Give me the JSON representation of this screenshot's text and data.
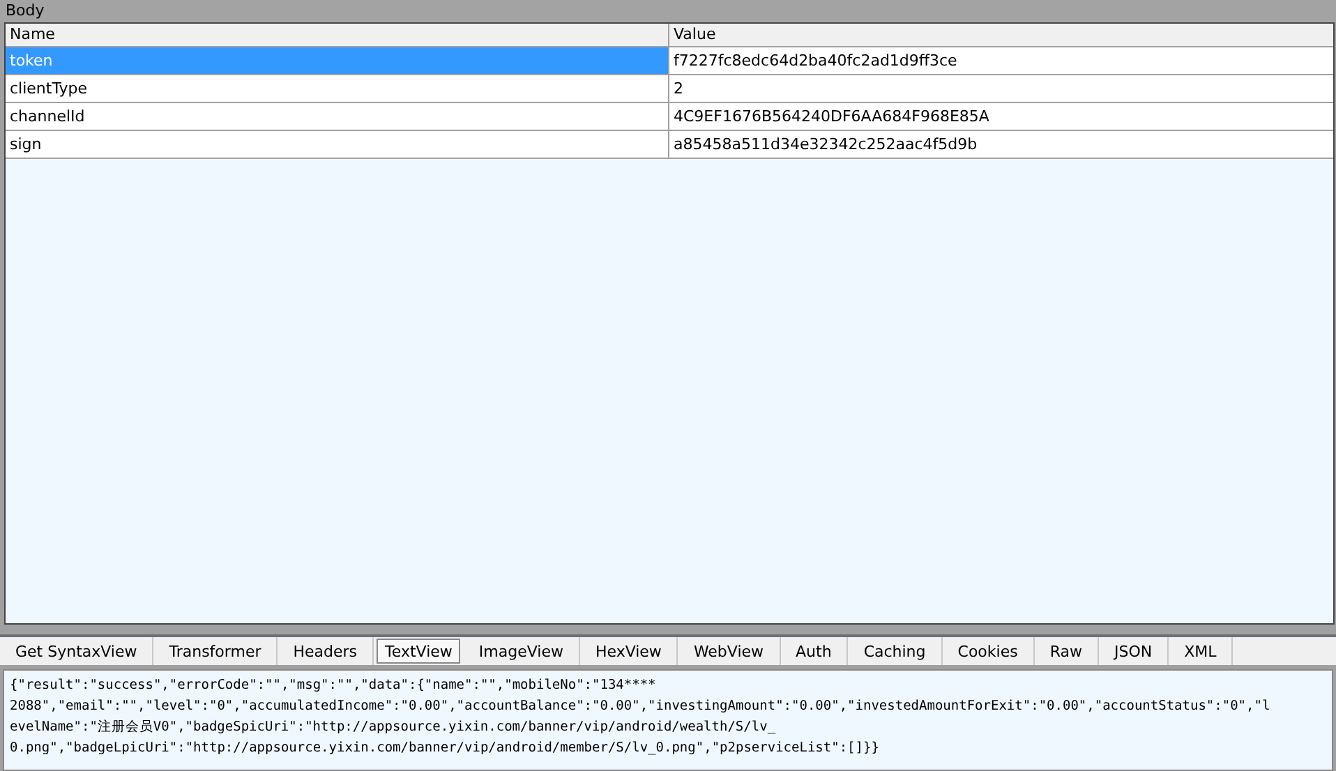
{
  "panel": {
    "title": "Body"
  },
  "table": {
    "columns": [
      "Name",
      "Value"
    ],
    "rows": [
      {
        "name": "token",
        "value": "f7227fc8edc64d2ba40fc2ad1d9ff3ce",
        "selected": true
      },
      {
        "name": "clientType",
        "value": "2",
        "selected": false
      },
      {
        "name": "channelId",
        "value": "4C9EF1676B564240DF6AA684F968E85A",
        "selected": false
      },
      {
        "name": "sign",
        "value": "a85458a511d34e32342c252aac4f5d9b",
        "selected": false
      }
    ]
  },
  "tabs": [
    {
      "label": "Get SyntaxView",
      "selected": false
    },
    {
      "label": "Transformer",
      "selected": false
    },
    {
      "label": "Headers",
      "selected": false
    },
    {
      "label": "TextView",
      "selected": true
    },
    {
      "label": "ImageView",
      "selected": false
    },
    {
      "label": "HexView",
      "selected": false
    },
    {
      "label": "WebView",
      "selected": false
    },
    {
      "label": "Auth",
      "selected": false
    },
    {
      "label": "Caching",
      "selected": false
    },
    {
      "label": "Cookies",
      "selected": false
    },
    {
      "label": "Raw",
      "selected": false
    },
    {
      "label": "JSON",
      "selected": false
    },
    {
      "label": "XML",
      "selected": false
    }
  ],
  "response_text": [
    "{\"result\":\"success\",\"errorCode\":\"\",\"msg\":\"\",\"data\":{\"name\":\"\",\"mobileNo\":\"134****",
    "2088\",\"email\":\"\",\"level\":\"0\",\"accumulatedIncome\":\"0.00\",\"accountBalance\":\"0.00\",\"investingAmount\":\"0.00\",\"investedAmountForExit\":\"0.00\",\"accountStatus\":\"0\",\"l",
    "evelName\":\"注册会员V0\",\"badgeSpicUri\":\"http://appsource.yixin.com/banner/vip/android/wealth/S/lv_",
    "0.png\",\"badgeLpicUri\":\"http://appsource.yixin.com/banner/vip/android/member/S/lv_0.png\",\"p2pserviceList\":[]}}"
  ]
}
